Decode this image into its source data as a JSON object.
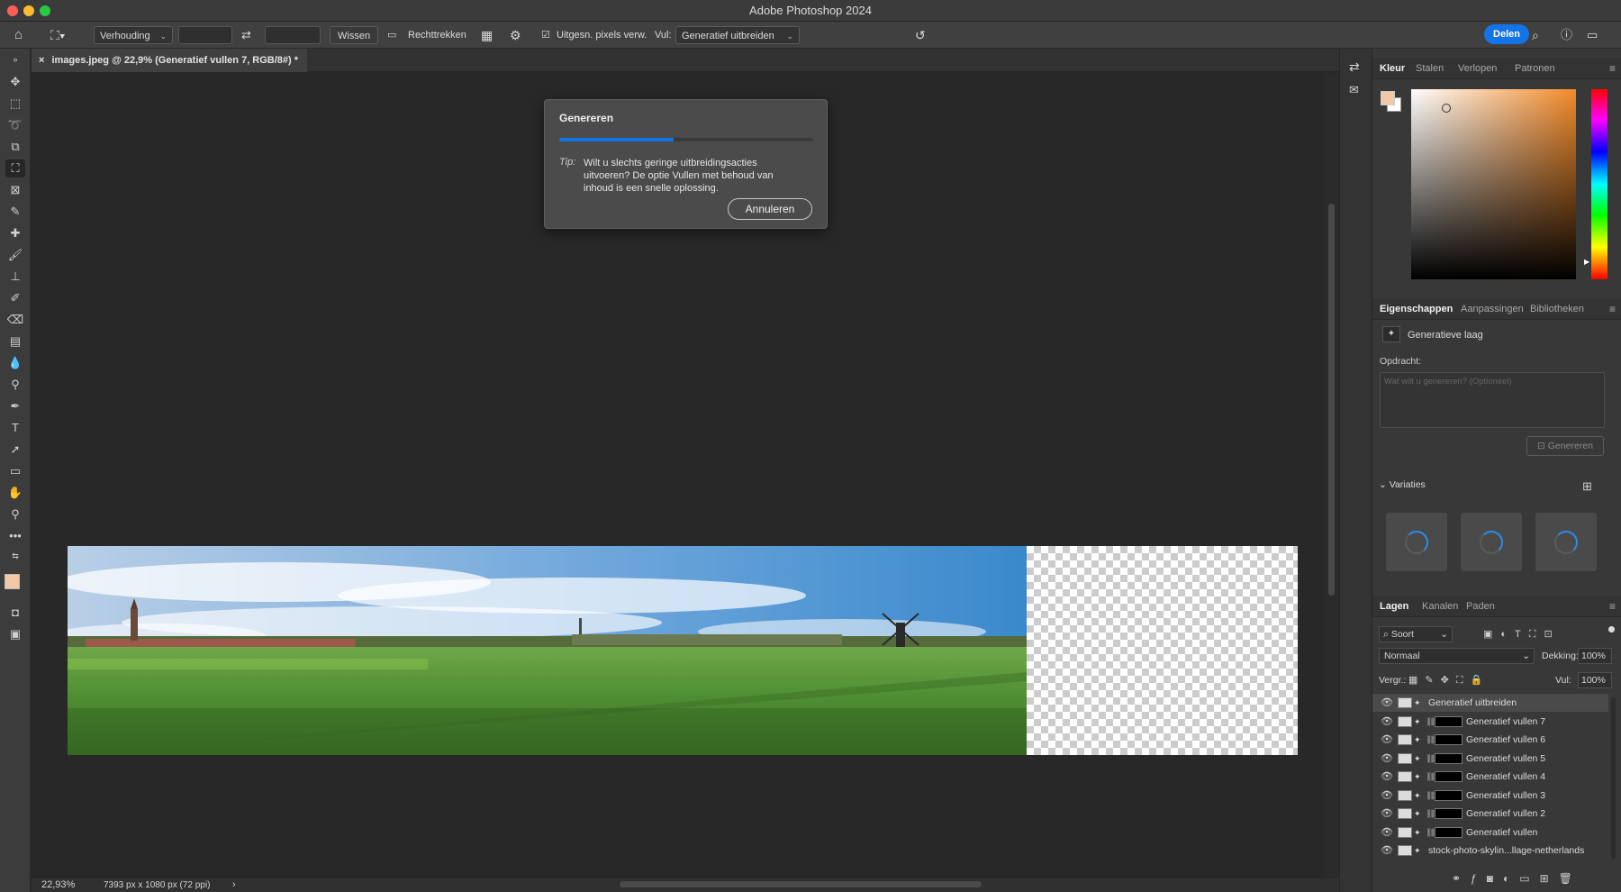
{
  "window": {
    "title": "Adobe Photoshop 2024"
  },
  "options_bar": {
    "ratio_select": "Verhouding",
    "clear_button": "Wissen",
    "straighten_label": "Rechttrekken",
    "delete_cropped_label": "Uitgesn. pixels verw.",
    "fill_label": "Vul:",
    "fill_select": "Generatief uitbreiden",
    "share_button": "Delen"
  },
  "document": {
    "tab_title": "images.jpeg @ 22,9% (Generatief vullen 7, RGB/8#) *",
    "zoom": "22,93%",
    "dimensions": "7393 px x 1080 px (72 ppi)"
  },
  "dialog": {
    "title": "Genereren",
    "progress": 0.45,
    "tip_label": "Tip:",
    "tip_text": "Wilt u slechts geringe uitbreidingsacties uitvoeren? De optie Vullen met behoud van inhoud is een snelle oplossing.",
    "cancel_button": "Annuleren"
  },
  "color_panel": {
    "tabs": [
      "Kleur",
      "Stalen",
      "Verlopen",
      "Patronen"
    ],
    "foreground": "#f2c9a8",
    "background": "#ffffff"
  },
  "properties_panel": {
    "tabs": [
      "Eigenschappen",
      "Aanpassingen",
      "Bibliotheken"
    ],
    "layer_type": "Generatieve laag",
    "prompt_label": "Opdracht:",
    "prompt_placeholder": "Wat wilt u genereren? (Optioneel)",
    "generate_button": "Genereren",
    "variations_label": "Variaties"
  },
  "layers_panel": {
    "tabs": [
      "Lagen",
      "Kanalen",
      "Paden"
    ],
    "filter_select": "Soort",
    "blend_mode": "Normaal",
    "opacity_label": "Dekking:",
    "opacity_value": "100%",
    "lock_label": "Vergr.:",
    "fill_label": "Vul:",
    "fill_value": "100%",
    "layers": [
      "Generatief uitbreiden",
      "Generatief vullen 7",
      "Generatief vullen 6",
      "Generatief vullen 5",
      "Generatief vullen 4",
      "Generatief vullen 3",
      "Generatief vullen 2",
      "Generatief vullen",
      "stock-photo-skylin...llage-netherlands"
    ],
    "selected_index": 0
  },
  "colors": {
    "accent": "#1473e6",
    "panel_bg": "#383838",
    "canvas_bg": "#282828"
  }
}
